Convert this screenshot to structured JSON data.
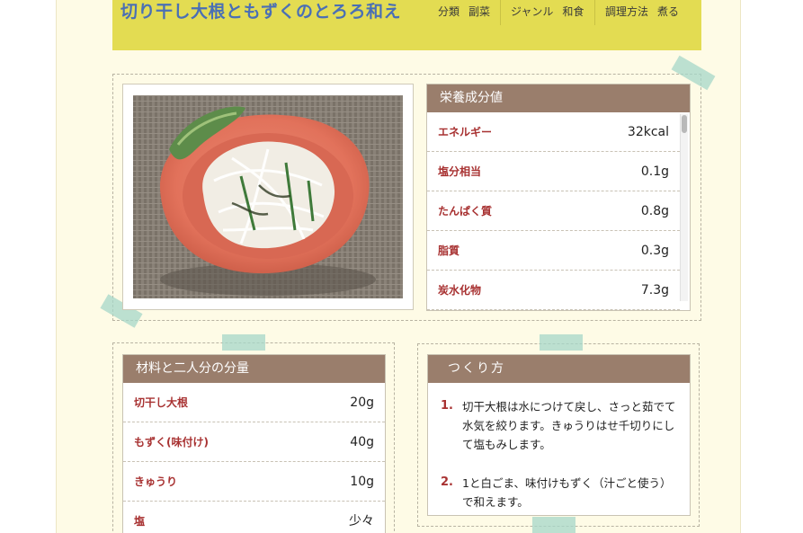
{
  "recipe": {
    "title": "切り干し大根ともずくのとろろ和え",
    "meta": [
      {
        "label": "分類",
        "value": "副菜"
      },
      {
        "label": "ジャンル",
        "value": "和食"
      },
      {
        "label": "調理方法",
        "value": "煮る"
      }
    ]
  },
  "photo": {
    "alt": "切り干し大根ともずくのとろろ和え"
  },
  "nutrition": {
    "title": "栄養成分値",
    "rows": [
      {
        "name": "エネルギー",
        "value": "32kcal"
      },
      {
        "name": "塩分相当",
        "value": "0.1g"
      },
      {
        "name": "たんぱく質",
        "value": "0.8g"
      },
      {
        "name": "脂質",
        "value": "0.3g"
      },
      {
        "name": "炭水化物",
        "value": "7.3g"
      }
    ]
  },
  "ingredients": {
    "title": "材料と二人分の分量",
    "rows": [
      {
        "name": "切干し大根",
        "amount": "20g"
      },
      {
        "name": "もずく(味付け)",
        "amount": "40g"
      },
      {
        "name": "きゅうり",
        "amount": "10g"
      },
      {
        "name": "塩",
        "amount": "少々"
      }
    ]
  },
  "method": {
    "title": "つくり方",
    "steps": [
      {
        "num": "1.",
        "text": "切干大根は水につけて戻し、さっと茹でて水気を絞ります。きゅうりはせ千切りにして塩もみします。"
      },
      {
        "num": "2.",
        "text": "1と白ごま、味付けもずく（汁ごと使う）で和えます。"
      }
    ]
  },
  "colors": {
    "header_bg": "#e3dc52",
    "title": "#4a6fb5",
    "panel_head": "#9a7e6c",
    "label_red": "#a83232",
    "page_bg": "#fefbe6",
    "tape": "#a5d7c8"
  }
}
